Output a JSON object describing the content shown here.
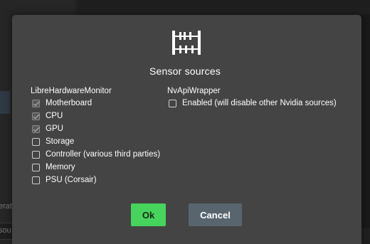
{
  "background": {
    "fragment_1": "erat",
    "fragment_2": "sou"
  },
  "dialog": {
    "title": "Sensor sources",
    "logo_icon": "abacus-icon",
    "groups": {
      "libre": {
        "title": "LibreHardwareMonitor",
        "items": [
          {
            "label": "Motherboard",
            "checked": true
          },
          {
            "label": "CPU",
            "checked": true
          },
          {
            "label": "GPU",
            "checked": true
          },
          {
            "label": "Storage",
            "checked": false
          },
          {
            "label": "Controller (various third parties)",
            "checked": false
          },
          {
            "label": "Memory",
            "checked": false
          },
          {
            "label": "PSU (Corsair)",
            "checked": false
          }
        ]
      },
      "nvapi": {
        "title": "NvApiWrapper",
        "items": [
          {
            "label": "Enabled (will disable other Nvidia sources)",
            "checked": false
          }
        ]
      }
    },
    "buttons": {
      "ok": "Ok",
      "cancel": "Cancel"
    }
  },
  "colors": {
    "dialog_bg": "#444444",
    "ok_button": "#47d45c",
    "cancel_button": "#58656f"
  }
}
